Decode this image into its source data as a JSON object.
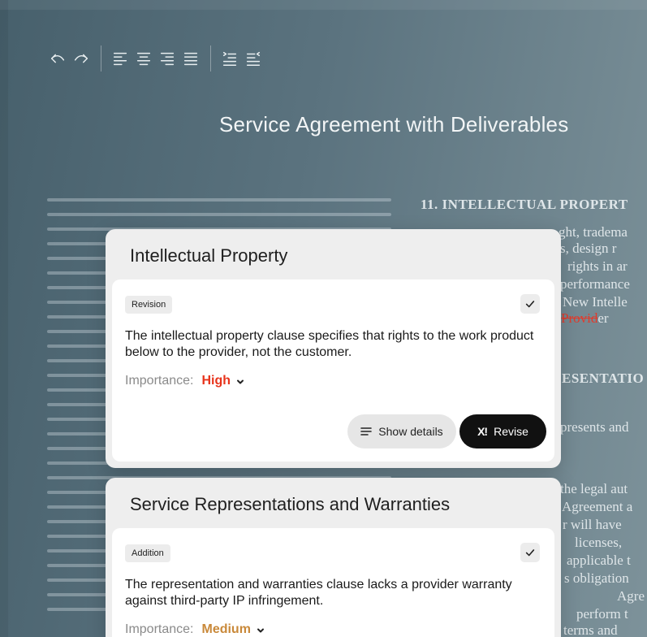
{
  "toolbar": {
    "icons": [
      "undo-icon",
      "redo-icon",
      "align-left-icon",
      "align-center-icon",
      "align-right-icon",
      "align-justify-icon",
      "indent-increase-icon",
      "indent-decrease-icon"
    ]
  },
  "document": {
    "title": "Service Agreement with Deliverables",
    "section_heading_1": "11. INTELLECTUAL PROPERT",
    "lines_1": [
      "ght, tradema",
      "s, design r",
      "rights in ar",
      "performance",
      "New Intelle"
    ],
    "struck_text": "Provid",
    "struck_suffix": "er",
    "section_heading_2": "ESENTATIO",
    "lines_2": [
      "presents and",
      "the legal aut",
      "Agreement a",
      "r will have",
      "licenses,",
      "applicable t",
      "s obligation",
      "Agre",
      "perform t",
      "terms and"
    ]
  },
  "cards": [
    {
      "title": "Intellectual Property",
      "tag": "Revision",
      "description": "The intellectual property clause specifies that rights to the work product below to the provider, not the customer.",
      "importance_label": "Importance:",
      "importance_value": "High",
      "importance_color": "#e8341c",
      "show_details_label": "Show details",
      "revise_label": "Revise",
      "revise_icon_text": "X!"
    },
    {
      "title": "Service Representations and Warranties",
      "tag": "Addition",
      "description": "The representation and warranties clause lacks a provider warranty against third-party IP infringement.",
      "importance_label": "Importance:",
      "importance_value": "Medium",
      "importance_color": "#c9893a"
    }
  ]
}
